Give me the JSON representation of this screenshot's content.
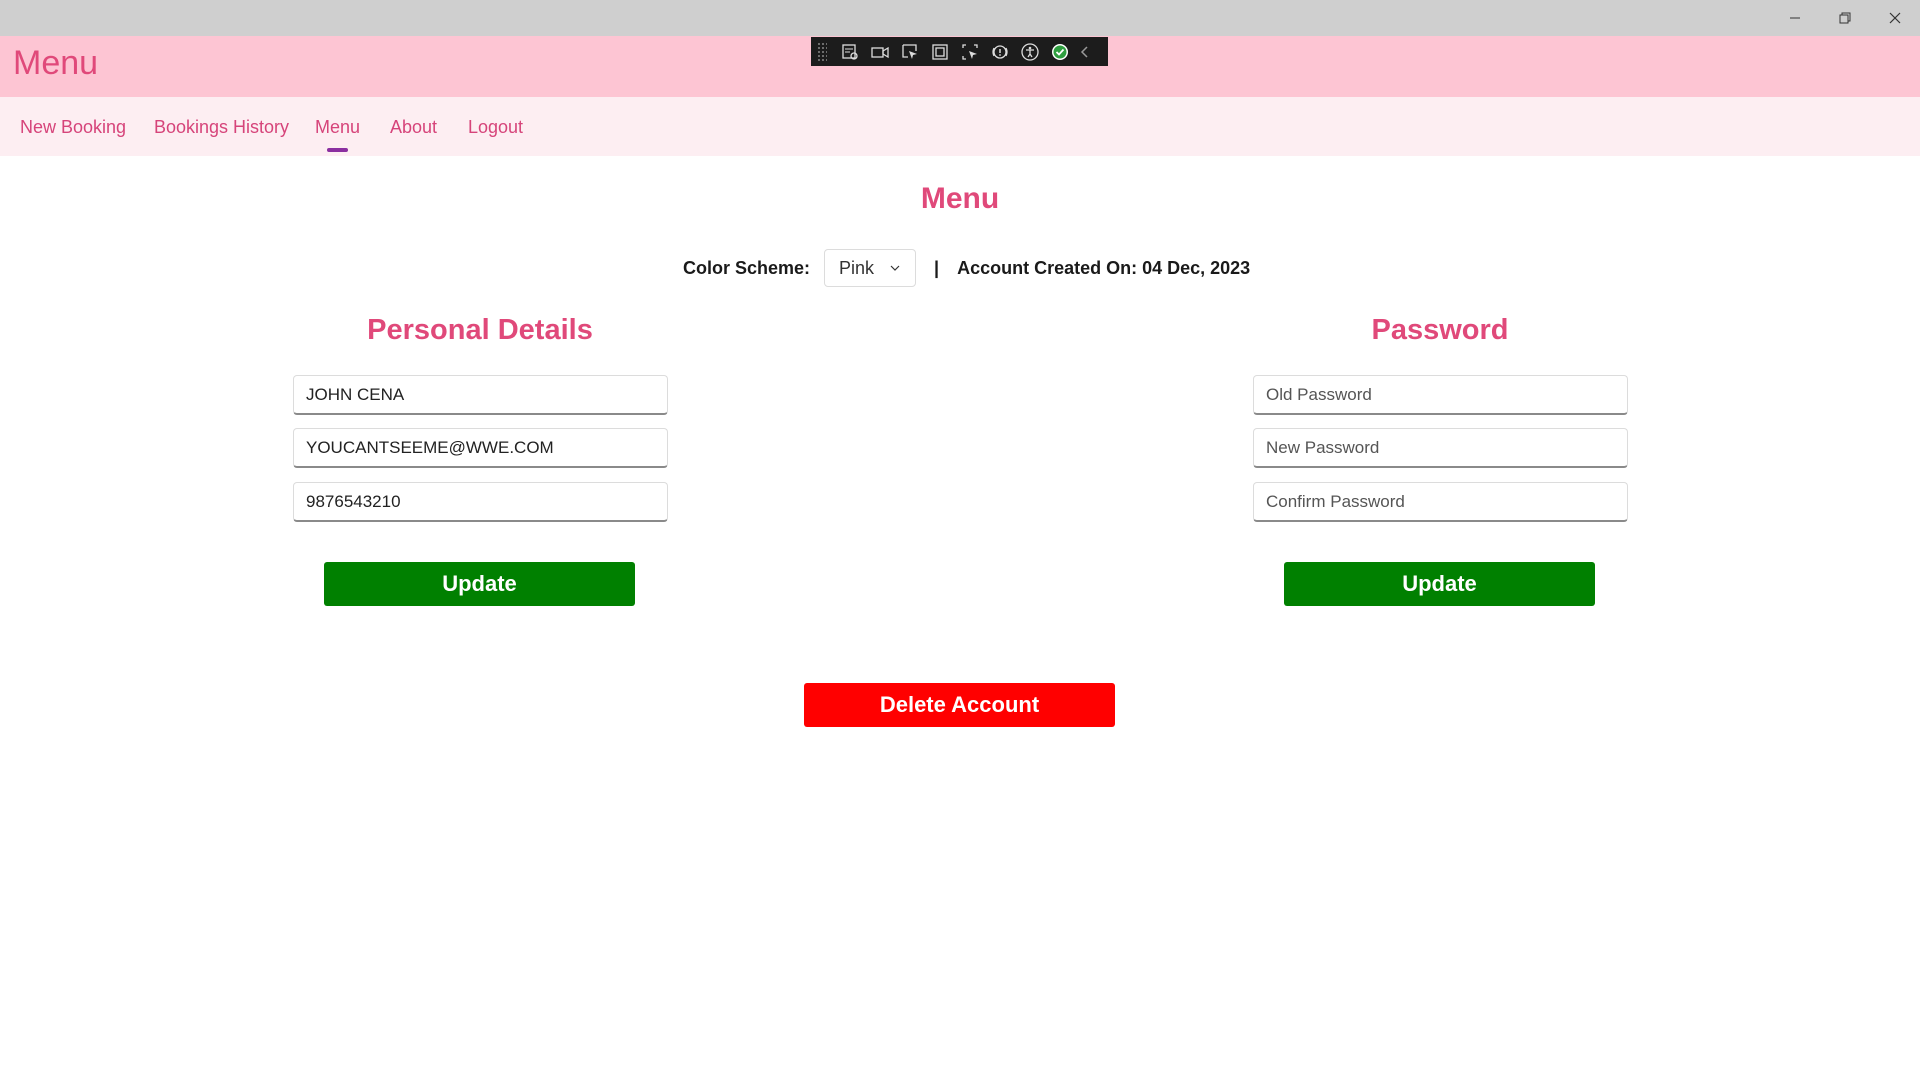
{
  "colors": {
    "header_bg": "#fdc5d3",
    "nav_bg": "#fdeef2",
    "accent": "#e0497a",
    "nav_indicator": "#8b2fa0",
    "update_button": "#008000",
    "delete_button": "#ff0000"
  },
  "window": {
    "controls": [
      "minimize-icon",
      "restore-icon",
      "close-icon"
    ]
  },
  "header": {
    "title": "Menu"
  },
  "devtools": {
    "icons": [
      "live-visual-tree-icon",
      "video-camera-icon",
      "select-element-icon",
      "display-layout-adorners-icon",
      "track-focus-icon",
      "binding-failures-icon",
      "accessibility-icon",
      "hot-reload-check-icon",
      "collapse-chevron-icon"
    ]
  },
  "nav": {
    "items": [
      {
        "label": "New Booking"
      },
      {
        "label": "Bookings History"
      },
      {
        "label": "Menu",
        "active": true
      },
      {
        "label": "About"
      },
      {
        "label": "Logout"
      }
    ]
  },
  "main": {
    "heading": "Menu",
    "color_scheme_label": "Color Scheme:",
    "color_scheme_value": "Pink",
    "separator": "|",
    "account_created": "Account Created On: 04 Dec, 2023"
  },
  "personal": {
    "title": "Personal Details",
    "name_value": "JOHN CENA",
    "email_value": "YOUCANTSEEME@WWE.COM",
    "phone_value": "9876543210",
    "update_label": "Update"
  },
  "password": {
    "title": "Password",
    "old_placeholder": "Old Password",
    "new_placeholder": "New Password",
    "confirm_placeholder": "Confirm Password",
    "update_label": "Update"
  },
  "delete_label": "Delete Account"
}
